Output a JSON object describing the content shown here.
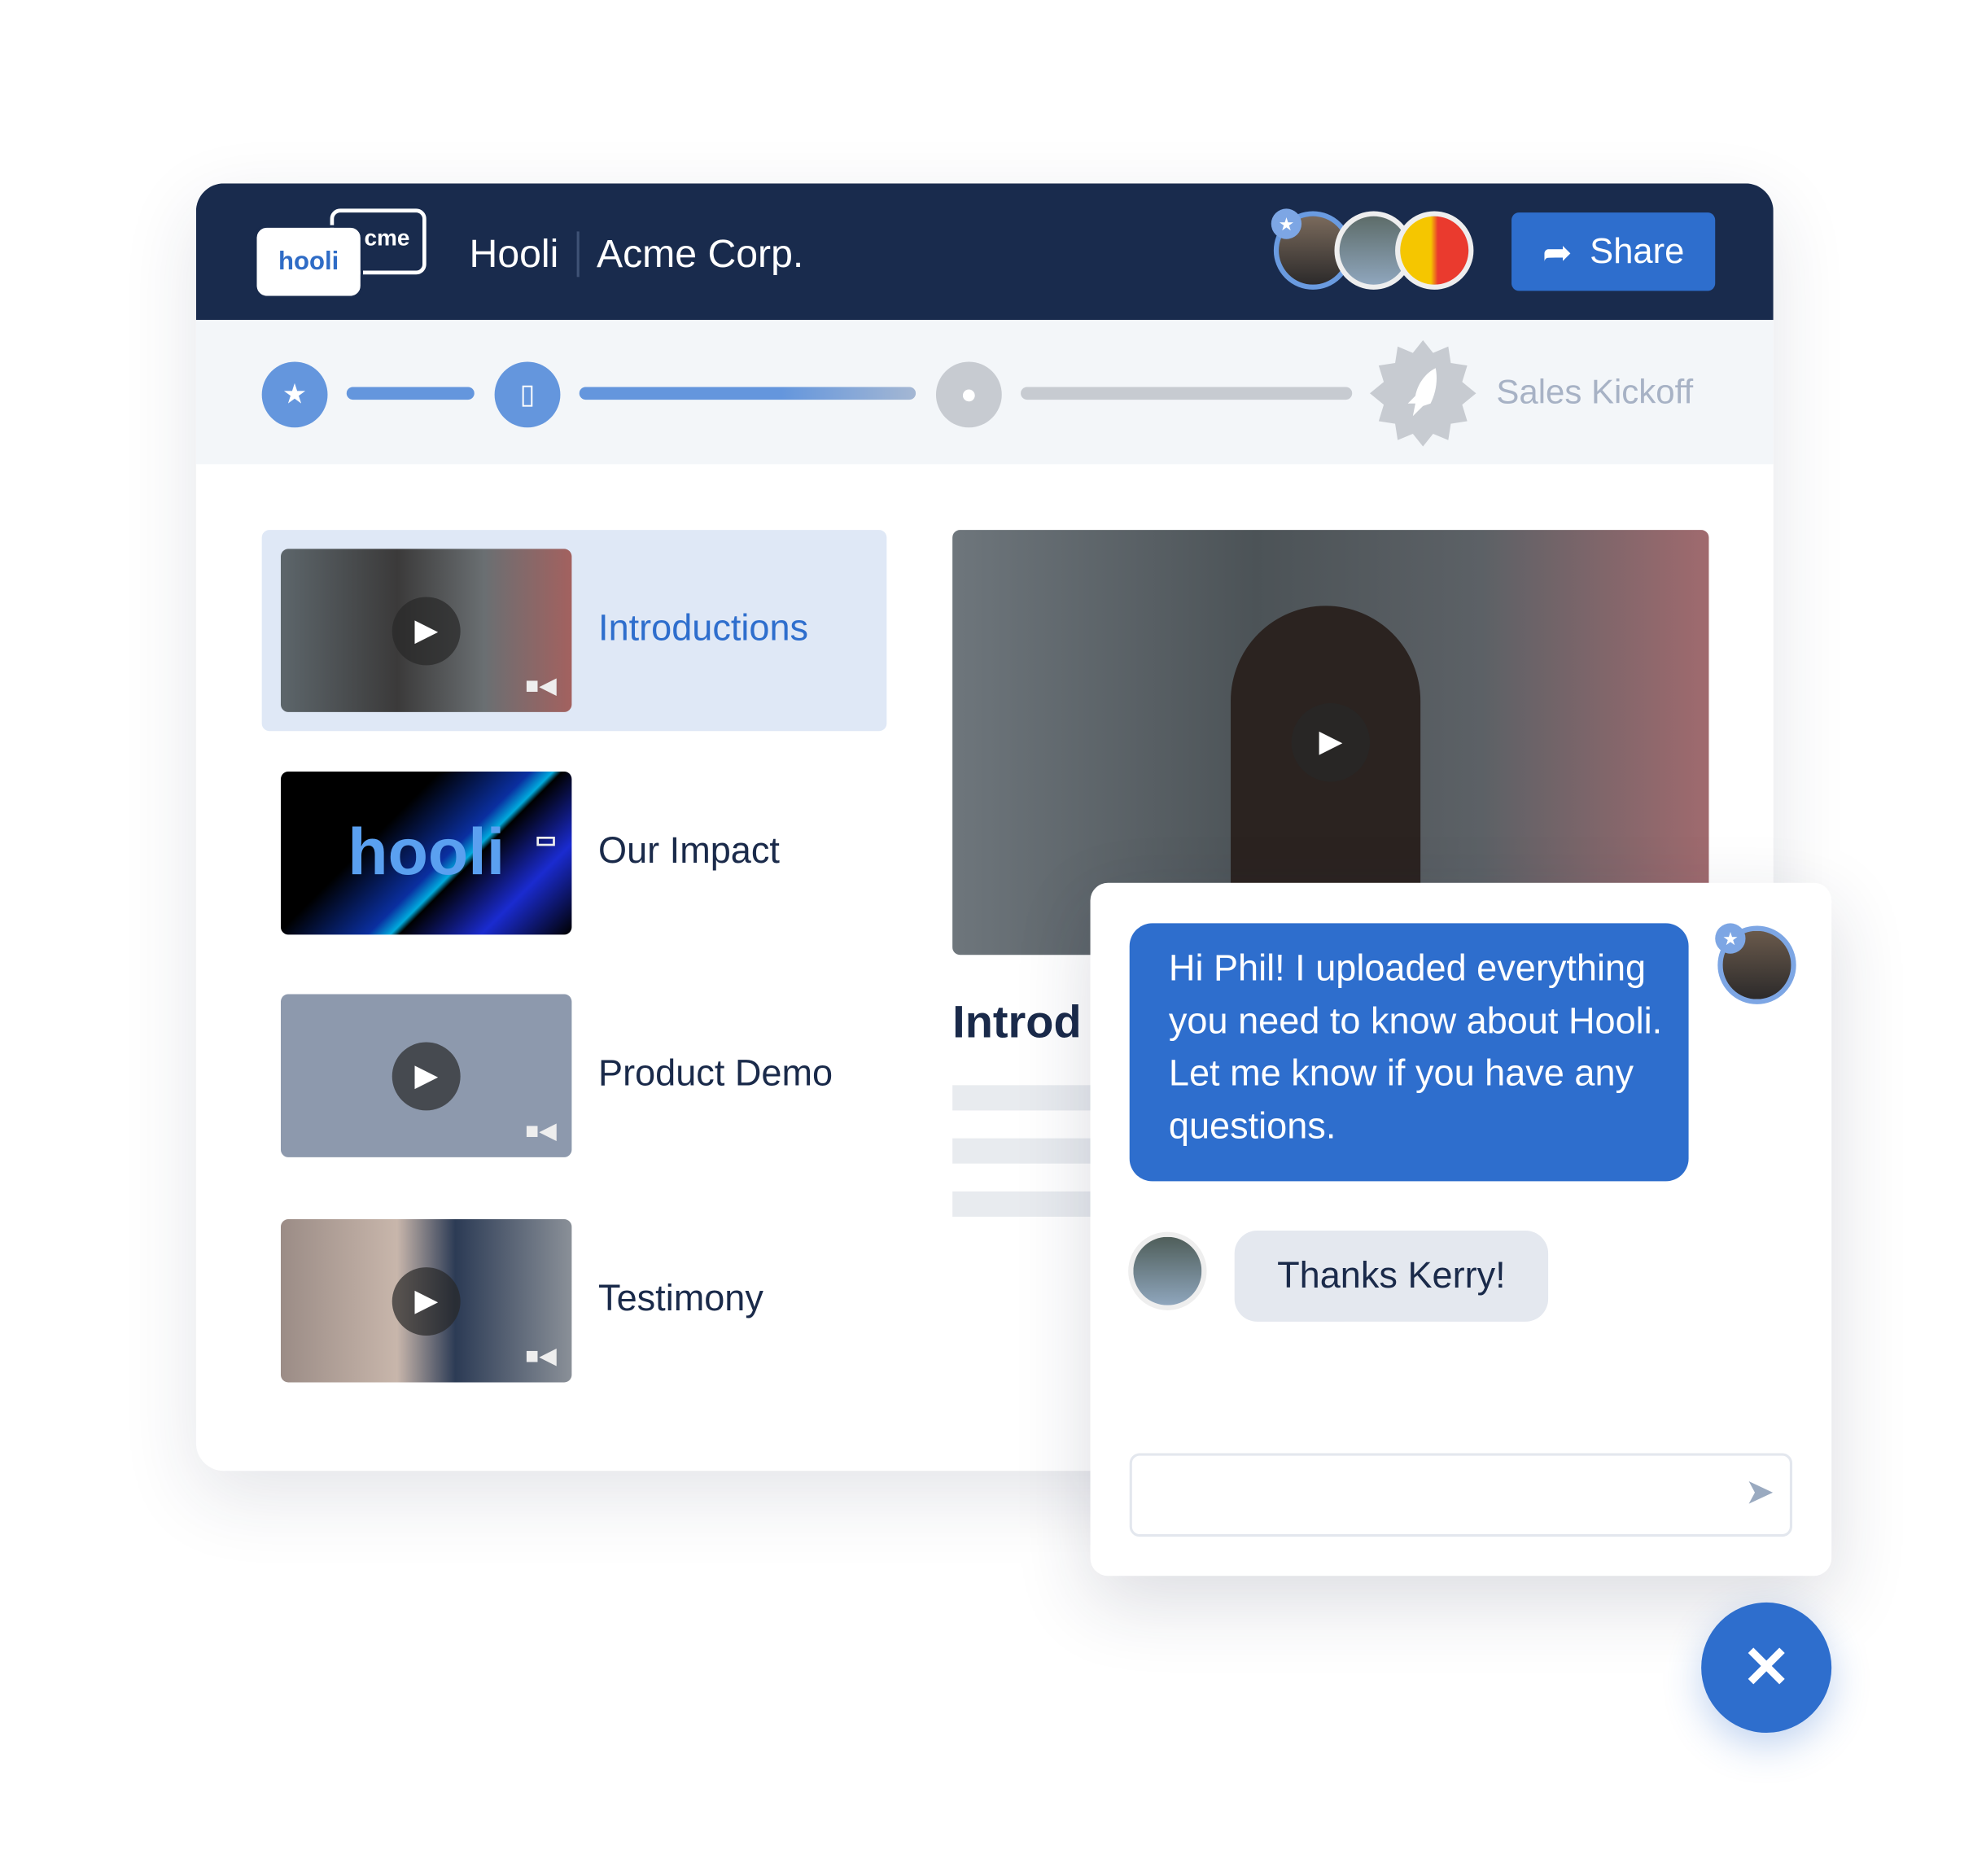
{
  "header": {
    "logo_hooli": "hooli",
    "logo_acme": "cme",
    "company": "Hooli",
    "client": "Acme Corp.",
    "share_label": "Share"
  },
  "progress": {
    "steps": [
      "star-icon",
      "scroll-icon",
      "user-icon",
      "rocket-icon"
    ],
    "completed_steps": 2,
    "milestone": "Sales Kickoff"
  },
  "playlist": {
    "items": [
      {
        "label": "Introductions",
        "type": "video",
        "active": true
      },
      {
        "label": "Our Impact",
        "type": "presentation",
        "thumb_text": "hooli"
      },
      {
        "label": "Product Demo",
        "type": "video"
      },
      {
        "label": "Testimony",
        "type": "video"
      }
    ]
  },
  "main": {
    "title": "Introd"
  },
  "chat": {
    "messages": [
      {
        "from": "Kerry",
        "text": "Hi Phil! I uploaded everything you need to know about Hooli. Let me know if you have any questions."
      },
      {
        "from": "Phil",
        "text": "Thanks Kerry!"
      }
    ],
    "input_value": ""
  },
  "colors": {
    "brand": "#2e6ecd",
    "header": "#192b4d"
  }
}
